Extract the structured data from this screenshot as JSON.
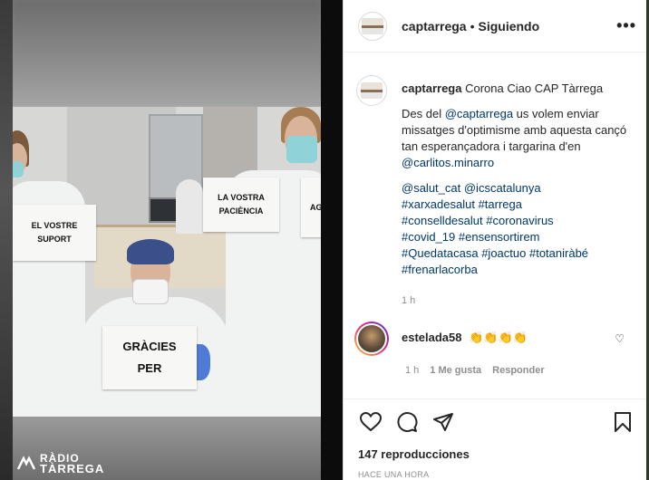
{
  "header": {
    "username": "captarrega",
    "separator": "•",
    "follow_status": "Siguiendo",
    "more_icon": "more-horizontal-icon"
  },
  "caption": {
    "username": "captarrega",
    "title": "Corona Ciao CAP Tàrrega",
    "intro": "Des del ",
    "mention1": "@captarrega",
    "text1": " us volem enviar missatges d'optimisme amb aquesta cançó tan esperançadora i targarina d'en ",
    "mention2": "@carlitos.minarro",
    "tags": [
      "@salut_cat",
      "@icscatalunya",
      "#xarxadesalut",
      "#tarrega",
      "#conselldesalut",
      "#coronavirus",
      "#covid_19",
      "#ensensortirem",
      "#Quedatacasa",
      "#joactuo",
      "#totaniràbé",
      "#frenarlacorba"
    ],
    "time": "1 h"
  },
  "comment": {
    "username": "estelada58",
    "text": "👏👏👏👏",
    "time": "1 h",
    "likes": "1 Me gusta",
    "reply": "Responder"
  },
  "actions": {
    "icons": [
      "heart-icon",
      "comment-icon",
      "share-icon",
      "bookmark-icon"
    ],
    "views": "147 reproducciones",
    "posted": "HACE UNA HORA"
  },
  "video": {
    "signs": {
      "left": "EL VOSTRE SUPORT",
      "center_line1": "GRÀCIES",
      "center_line2": "PER",
      "right": "LA VOSTRA PACIÈNCIA",
      "far_right": "AG"
    }
  },
  "watermark": {
    "line1": "RÀDIO",
    "line2": "TÀRREGA"
  },
  "colors": {
    "link": "#00376b",
    "muted": "#8e8e8e",
    "text": "#262626"
  }
}
